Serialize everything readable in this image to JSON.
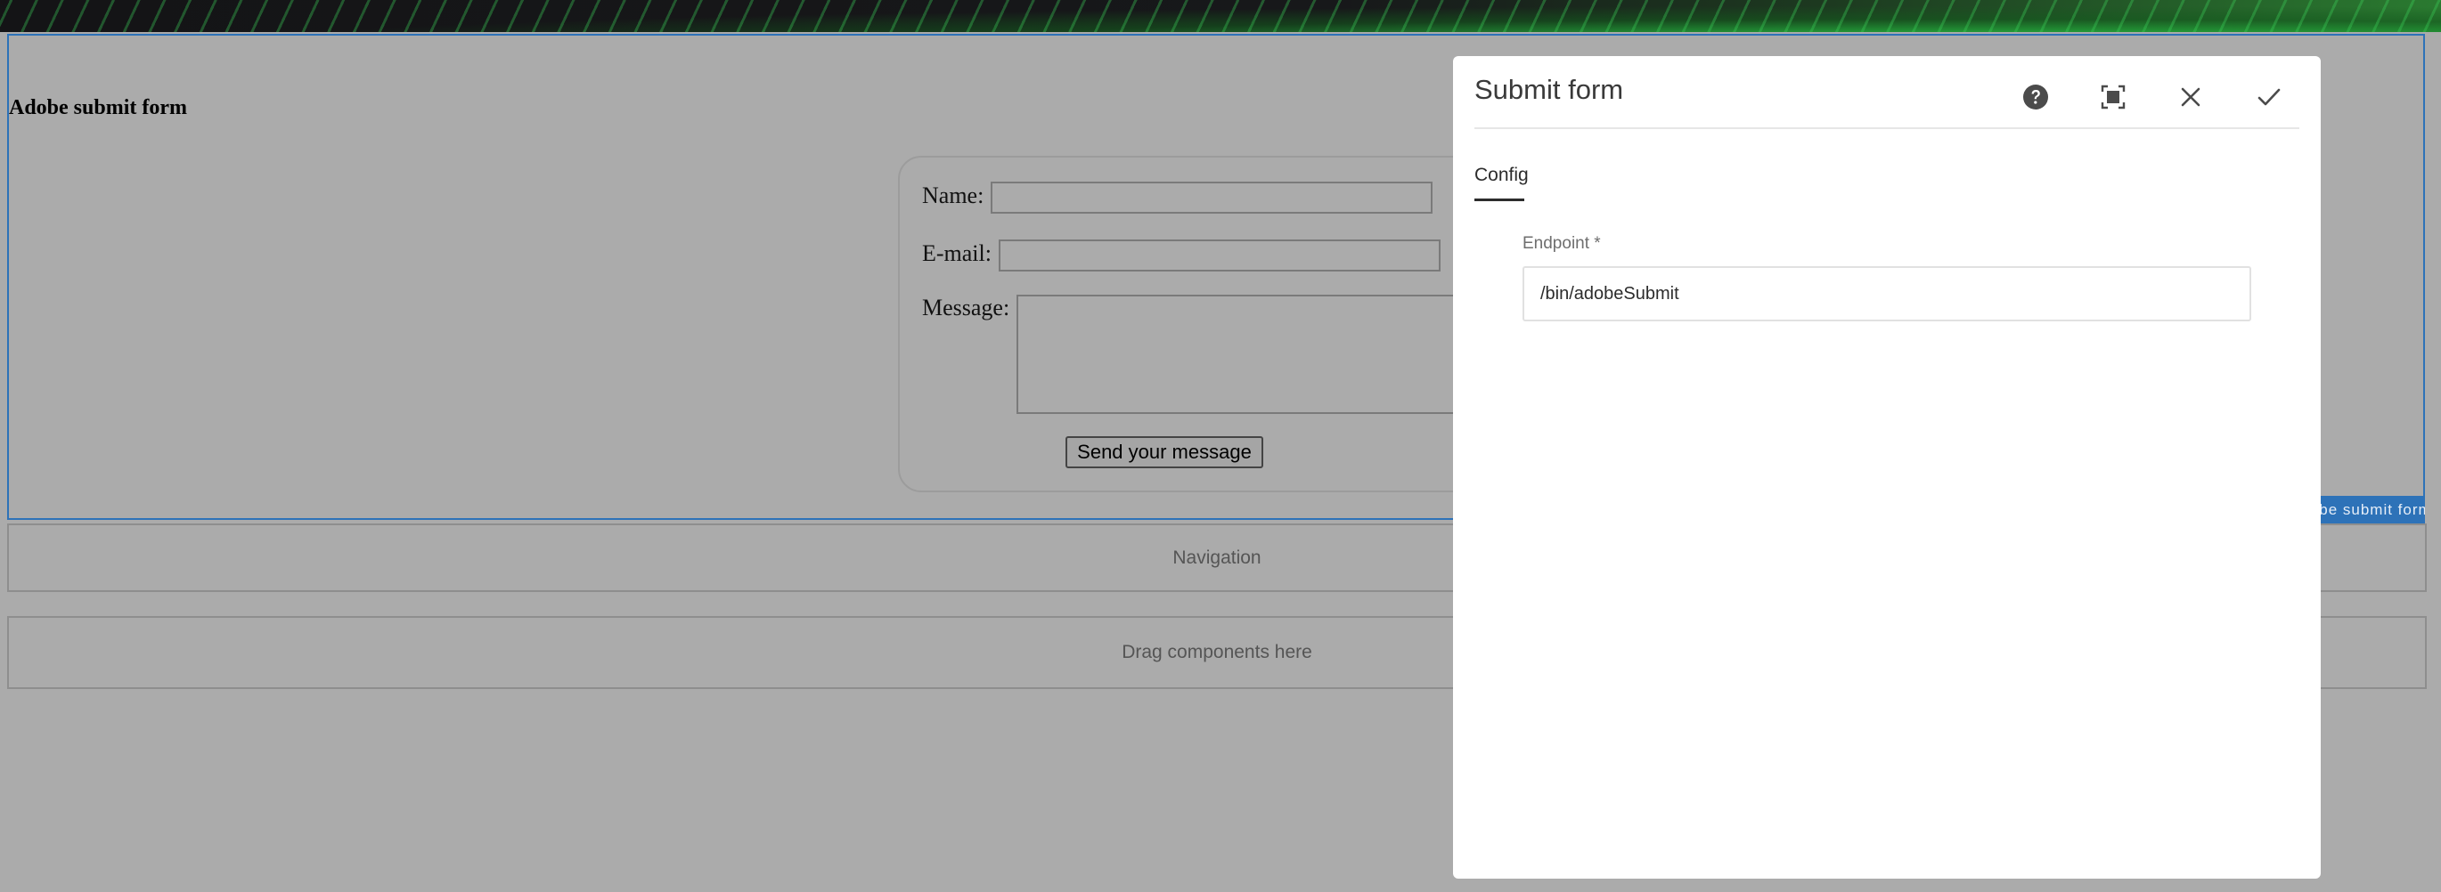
{
  "page": {
    "heading": "Adobe submit form",
    "component_tag": "Adobe submit form",
    "form": {
      "name_label": "Name:",
      "email_label": "E-mail:",
      "message_label": "Message:",
      "name_value": "",
      "email_value": "",
      "message_value": "",
      "submit_label": "Send your message"
    },
    "navigation_placeholder": "Navigation",
    "drop_zone_placeholder": "Drag components here"
  },
  "dialog": {
    "title": "Submit form",
    "icons": [
      "help-icon",
      "fullscreen-icon",
      "close-icon",
      "check-icon"
    ],
    "tabs": [
      {
        "label": "Config",
        "active": true
      }
    ],
    "fields": {
      "endpoint": {
        "label": "Endpoint *",
        "value": "/bin/adobeSubmit"
      }
    }
  },
  "colors": {
    "overlay_gray": "#ababab",
    "selection_blue": "#2d72b8",
    "dialog_bg": "#ffffff"
  }
}
